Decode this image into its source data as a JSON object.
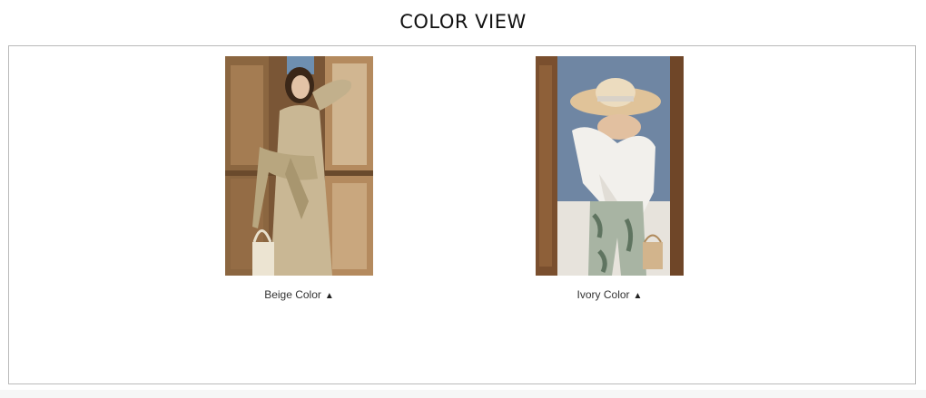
{
  "header": {
    "title": "COLOR VIEW"
  },
  "swatches": [
    {
      "label": "Beige Color",
      "arrow": "▲",
      "image": "model-beige-wrap-dress"
    },
    {
      "label": "Ivory Color",
      "arrow": "▲",
      "image": "model-ivory-top-straw-hat"
    }
  ],
  "colors": {
    "border": "#b9b9b9",
    "beige_outfit": "#c9b794",
    "ivory_outfit": "#f2f0ec"
  }
}
